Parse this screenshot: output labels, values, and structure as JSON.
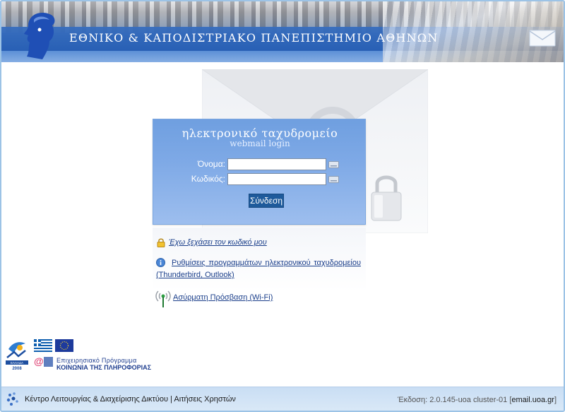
{
  "header": {
    "title": "ΕΘΝΙΚΟ & ΚΑΠΟΔΙΣΤΡΙΑΚΟ ΠΑΝΕΠΙΣΤΗΜΙΟ ΑΘΗΝΩΝ",
    "logo_icon": "athena-head-logo",
    "mail_icon": "envelope-icon"
  },
  "login": {
    "title": "ηλεκτρονικό ταχυδρομείο",
    "subtitle": "webmail login",
    "username_label": "Όνομα:",
    "username_value": "",
    "password_label": "Κωδικός:",
    "password_value": "",
    "submit_label": "Σύνδεση"
  },
  "links": {
    "forgot_password": "Έχω ξεχάσει τον κωδικό μου",
    "mail_settings_line1": "Ρυθμίσεις προγραμμάτων ηλεκτρονικού ταχυδρομείου",
    "mail_settings_line2": "(Thunderbird, Outlook)",
    "wifi": "Ασύρματη Πρόσβαση (Wi-Fi)"
  },
  "program": {
    "line1": "Επιχειρησιακό Πρόγραμμα",
    "line2": "ΚΟΙΝΩΝΙΑ ΤΗΣ ΠΛΗΡΟΦΟΡΙΑΣ",
    "badge_text": "ΕΛΛΑΔΑ",
    "badge_year": "2008"
  },
  "footer": {
    "left_text": "Κέντρο Λειτουργίας & Διαχείρισης Δικτύου | Αιτήσεις Χρηστών",
    "version_text": "Έκδοση: 2.0.145-uoa cluster-01 [",
    "host_text": "email.uoa.gr",
    "close_bracket": "]"
  },
  "colors": {
    "accent": "#2f69bd",
    "panel": "#7ea9e6",
    "button": "#1e5a9b",
    "link": "#1a3e8a"
  }
}
